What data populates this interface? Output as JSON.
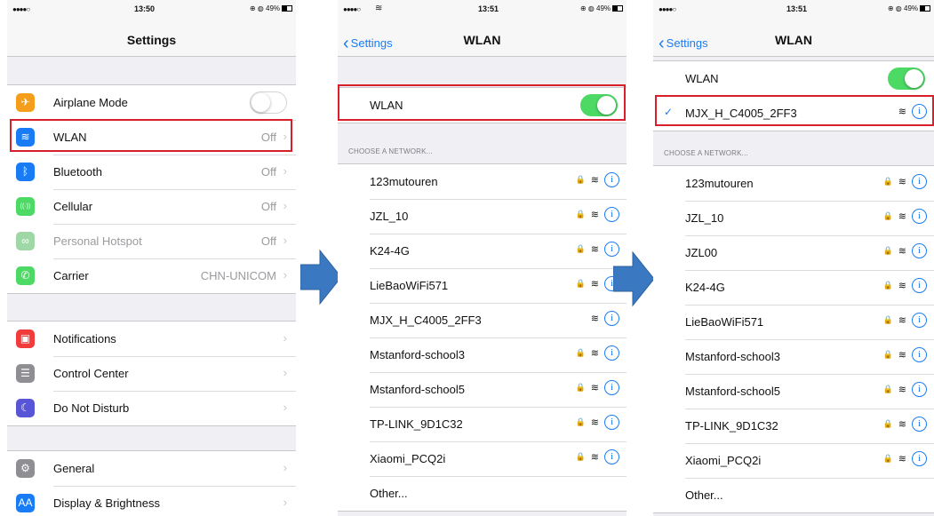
{
  "colors": {
    "accent": "#1a7cf5",
    "toggle_on": "#4cd964",
    "highlight": "#d9202a",
    "arrow": "#3b78c2"
  },
  "screen1": {
    "status": {
      "signal": "●●●●○",
      "time": "13:50",
      "right": "⊕ ◍ 49%"
    },
    "title": "Settings",
    "group1": [
      {
        "label": "Airplane Mode",
        "icon": "airplane-icon",
        "glyph": "✈",
        "color": "#f59e1b",
        "toggle": "off"
      },
      {
        "label": "WLAN",
        "icon": "wifi-icon",
        "glyph": "≋",
        "color": "#1a7cf5",
        "value": "Off"
      },
      {
        "label": "Bluetooth",
        "icon": "bluetooth-icon",
        "glyph": "ᛒ",
        "color": "#1a7cf5",
        "value": "Off"
      },
      {
        "label": "Cellular",
        "icon": "cellular-icon",
        "glyph": "((·))",
        "color": "#4cd964",
        "value": "Off"
      },
      {
        "label": "Personal Hotspot",
        "icon": "hotspot-icon",
        "glyph": "∞",
        "color": "#9fd8a6",
        "value": "Off",
        "dim": true
      },
      {
        "label": "Carrier",
        "icon": "phone-icon",
        "glyph": "✆",
        "color": "#4cd964",
        "value": "CHN-UNICOM"
      }
    ],
    "group2": [
      {
        "label": "Notifications",
        "icon": "notifications-icon",
        "glyph": "▣",
        "color": "#f23b3b"
      },
      {
        "label": "Control Center",
        "icon": "control-center-icon",
        "glyph": "☰",
        "color": "#8e8e93"
      },
      {
        "label": "Do Not Disturb",
        "icon": "moon-icon",
        "glyph": "☾",
        "color": "#5856d6"
      }
    ],
    "group3": [
      {
        "label": "General",
        "icon": "gear-icon",
        "glyph": "⚙",
        "color": "#8e8e93"
      },
      {
        "label": "Display & Brightness",
        "icon": "display-icon",
        "glyph": "AA",
        "color": "#1a7cf5"
      }
    ]
  },
  "screen2": {
    "status": {
      "signal": "●●●●○",
      "time": "13:51",
      "right": "⊕ ◍ 49%"
    },
    "back_label": "Settings",
    "title": "WLAN",
    "wlan_label": "WLAN",
    "wlan_toggle": "on",
    "section_header": "CHOOSE A NETWORK...",
    "networks": [
      {
        "name": "123mutouren",
        "lock": true
      },
      {
        "name": "JZL_10",
        "lock": true
      },
      {
        "name": "K24-4G",
        "lock": true
      },
      {
        "name": "LieBaoWiFi571",
        "lock": true
      },
      {
        "name": "MJX_H_C4005_2FF3",
        "lock": false
      },
      {
        "name": "Mstanford-school3",
        "lock": true
      },
      {
        "name": "Mstanford-school5",
        "lock": true
      },
      {
        "name": "TP-LINK_9D1C32",
        "lock": true
      },
      {
        "name": "Xiaomi_PCQ2i",
        "lock": true
      },
      {
        "name": "Other...",
        "lock": false,
        "other": true
      }
    ]
  },
  "screen3": {
    "status": {
      "signal": "●●●●○",
      "time": "13:51",
      "right": "⊕ ◍ 49%"
    },
    "back_label": "Settings",
    "title": "WLAN",
    "wlan_label": "WLAN",
    "wlan_toggle": "on",
    "connected": "MJX_H_C4005_2FF3",
    "section_header": "CHOOSE A NETWORK...",
    "networks": [
      {
        "name": "123mutouren",
        "lock": true
      },
      {
        "name": "JZL_10",
        "lock": true
      },
      {
        "name": "JZL00",
        "lock": true
      },
      {
        "name": "K24-4G",
        "lock": true
      },
      {
        "name": "LieBaoWiFi571",
        "lock": true
      },
      {
        "name": "Mstanford-school3",
        "lock": true
      },
      {
        "name": "Mstanford-school5",
        "lock": true
      },
      {
        "name": "TP-LINK_9D1C32",
        "lock": true
      },
      {
        "name": "Xiaomi_PCQ2i",
        "lock": true
      },
      {
        "name": "Other...",
        "lock": false,
        "other": true
      }
    ]
  },
  "icons": {
    "lock": "🔒",
    "wifi": "≋",
    "info": "i",
    "chevron": "›",
    "check": "✓",
    "back": "‹"
  }
}
